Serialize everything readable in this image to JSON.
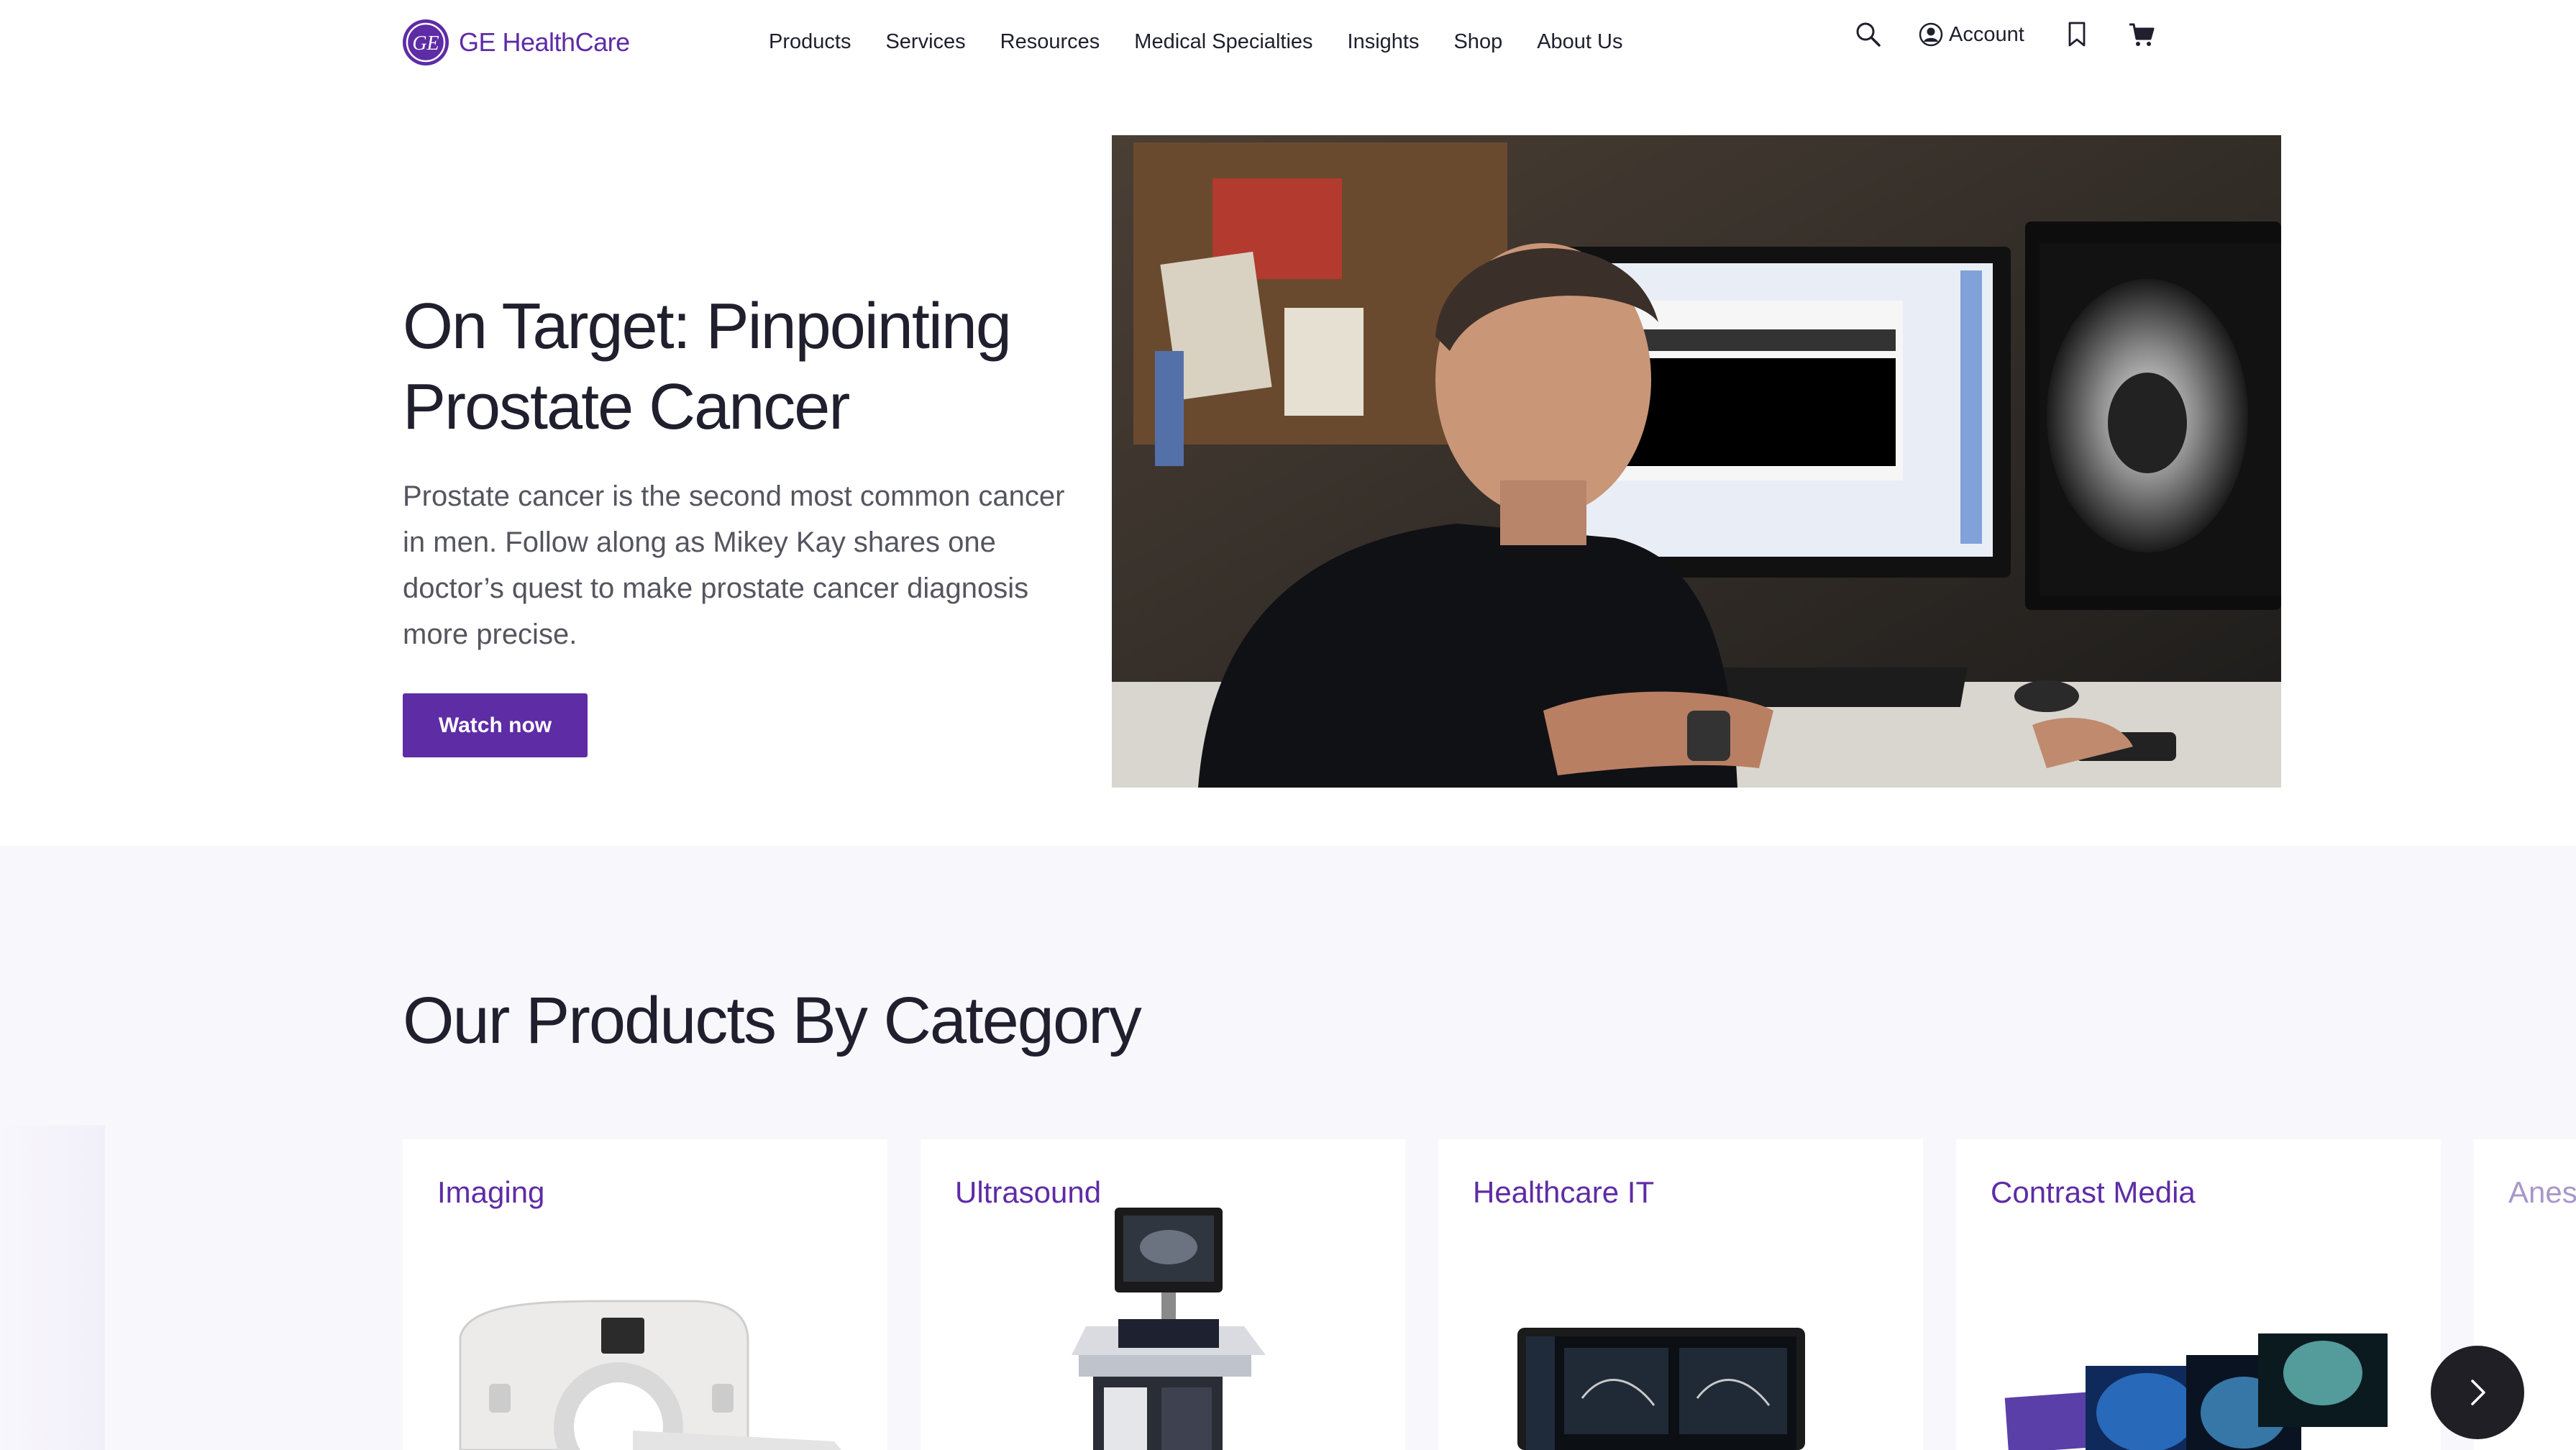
{
  "brand": {
    "name": "GE HealthCare",
    "color": "#5e2ca5",
    "logo_icon": "ge-monogram-icon"
  },
  "nav": {
    "items": [
      {
        "label": "Products"
      },
      {
        "label": "Services"
      },
      {
        "label": "Resources"
      },
      {
        "label": "Medical Specialties"
      },
      {
        "label": "Insights"
      },
      {
        "label": "Shop"
      },
      {
        "label": "About Us"
      }
    ]
  },
  "utility": {
    "search_icon": "search-icon",
    "account_label": "Account",
    "account_icon": "account-icon",
    "bookmark_icon": "bookmark-icon",
    "cart_icon": "cart-icon"
  },
  "hero": {
    "title": "On Target: Pinpointing Prostate Cancer",
    "description": "Prostate cancer is the second most common cancer in men. Follow along as Mikey Kay shares one doctor’s quest to make prostate cancer diagnosis more precise.",
    "cta_label": "Watch now"
  },
  "products": {
    "title": "Our Products By Category",
    "categories": [
      {
        "label": "Imaging"
      },
      {
        "label": "Ultrasound"
      },
      {
        "label": "Healthcare IT"
      },
      {
        "label": "Contrast Media"
      },
      {
        "label": "Anes"
      }
    ],
    "next_icon": "chevron-right-icon"
  },
  "colors": {
    "accent": "#5e2ca5",
    "section_bg": "#f8f7fc",
    "next_button": "#1f1f25"
  }
}
